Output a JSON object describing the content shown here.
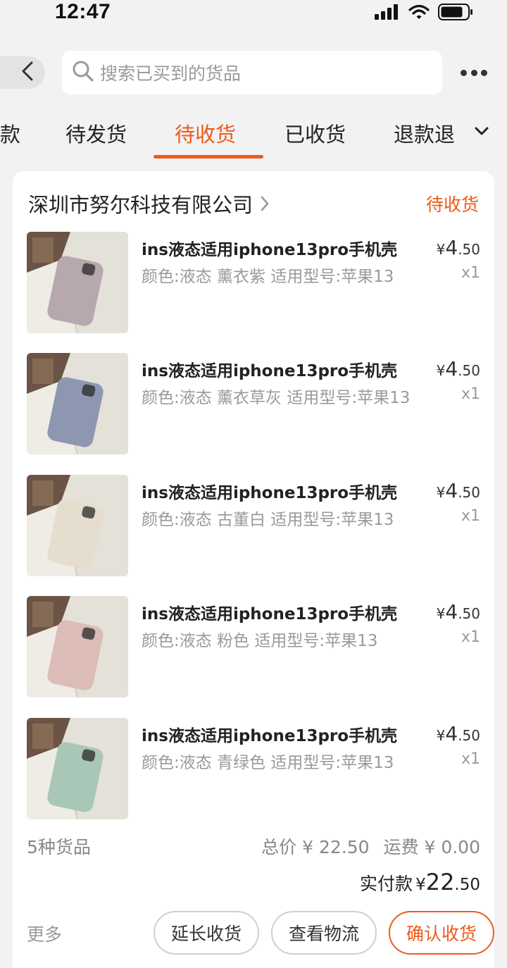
{
  "status_bar": {
    "time": "12:47"
  },
  "header": {
    "search_placeholder": "搜索已买到的货品"
  },
  "tabs": [
    {
      "label": "款",
      "active": false
    },
    {
      "label": "待发货",
      "active": false
    },
    {
      "label": "待收货",
      "active": true
    },
    {
      "label": "已收货",
      "active": false
    },
    {
      "label": "退款退",
      "active": false
    }
  ],
  "order": {
    "shop_name": "深圳市努尔科技有限公司",
    "status": "待收货",
    "items": [
      {
        "title": "ins液态适用iphone13pro手机壳",
        "spec": "颜色:液态 薰衣紫 适用型号:苹果13",
        "price_symbol": "¥",
        "price_int": "4",
        "price_dec": ".50",
        "qty": "x1",
        "case_color": "#b7a8ad"
      },
      {
        "title": "ins液态适用iphone13pro手机壳",
        "spec": "颜色:液态 薰衣草灰 适用型号:苹果13",
        "price_symbol": "¥",
        "price_int": "4",
        "price_dec": ".50",
        "qty": "x1",
        "case_color": "#8e97b2"
      },
      {
        "title": "ins液态适用iphone13pro手机壳",
        "spec": "颜色:液态 古董白 适用型号:苹果13",
        "price_symbol": "¥",
        "price_int": "4",
        "price_dec": ".50",
        "qty": "x1",
        "case_color": "#e5ddce"
      },
      {
        "title": "ins液态适用iphone13pro手机壳",
        "spec": "颜色:液态 粉色 适用型号:苹果13",
        "price_symbol": "¥",
        "price_int": "4",
        "price_dec": ".50",
        "qty": "x1",
        "case_color": "#dbbcb6"
      },
      {
        "title": "ins液态适用iphone13pro手机壳",
        "spec": "颜色:液态 青绿色 适用型号:苹果13",
        "price_symbol": "¥",
        "price_int": "4",
        "price_dec": ".50",
        "qty": "x1",
        "case_color": "#a9c7b6"
      }
    ],
    "item_count": "5种货品",
    "total_price": "总价 ¥ 22.50",
    "shipping": "运费 ¥ 0.00",
    "paid_label": "实付款",
    "paid_symbol": "¥",
    "paid_int": "22",
    "paid_dec": ".50"
  },
  "actions": {
    "more": "更多",
    "extend": "延长收货",
    "logistics": "查看物流",
    "confirm": "确认收货"
  },
  "colors": {
    "accent": "#ee5a1a",
    "background": "#f2f2f2"
  },
  "icons": [
    "signal-icon",
    "wifi-icon",
    "battery-icon",
    "back-arrow-icon",
    "search-icon",
    "more-icon",
    "chevron-down-icon",
    "chevron-right-icon"
  ]
}
